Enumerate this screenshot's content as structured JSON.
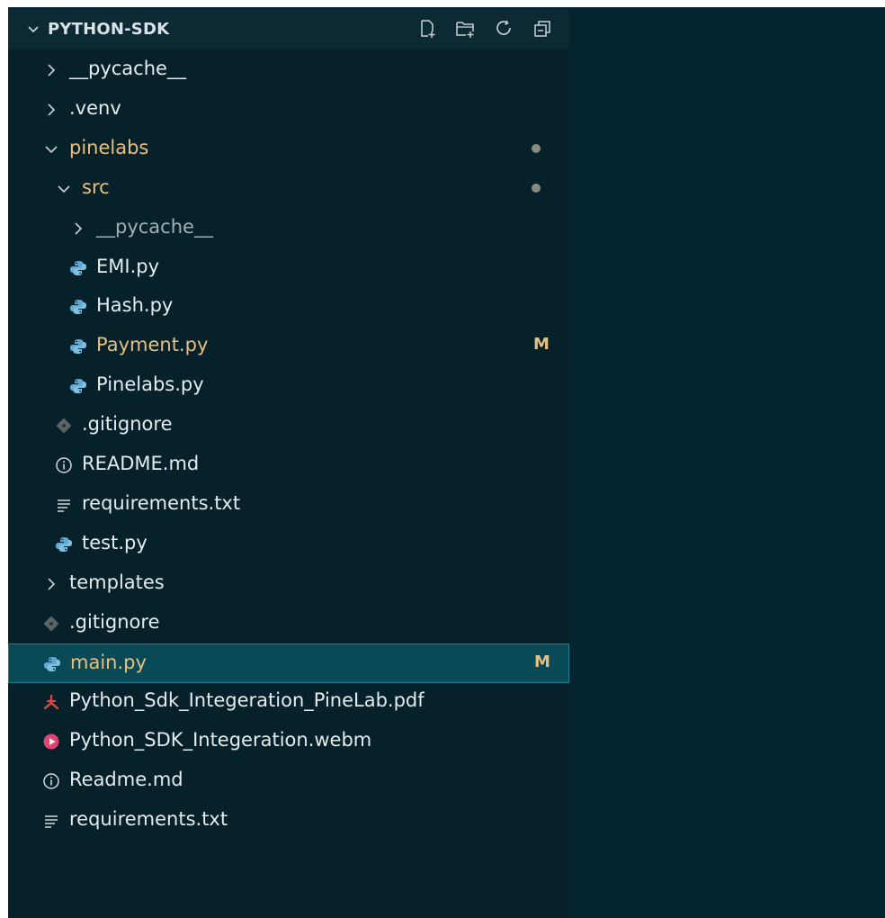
{
  "explorer": {
    "title": "PYTHON-SDK",
    "actions": [
      {
        "name": "new-file-icon"
      },
      {
        "name": "new-folder-icon"
      },
      {
        "name": "refresh-icon"
      },
      {
        "name": "collapse-all-icon"
      }
    ],
    "items": [
      {
        "label": "__pycache__",
        "kind": "folder",
        "expanded": false,
        "depth": 1
      },
      {
        "label": ".venv",
        "kind": "folder",
        "expanded": false,
        "depth": 1
      },
      {
        "label": "pinelabs",
        "kind": "folder",
        "expanded": true,
        "depth": 1,
        "modified_dot": true
      },
      {
        "label": "src",
        "kind": "folder",
        "expanded": true,
        "depth": 2,
        "modified_dot": true
      },
      {
        "label": "__pycache__",
        "kind": "folder",
        "expanded": false,
        "depth": 3
      },
      {
        "label": "EMI.py",
        "kind": "python",
        "depth": 3
      },
      {
        "label": "Hash.py",
        "kind": "python",
        "depth": 3
      },
      {
        "label": "Payment.py",
        "kind": "python",
        "depth": 3,
        "badge": "M"
      },
      {
        "label": "Pinelabs.py",
        "kind": "python",
        "depth": 3
      },
      {
        "label": ".gitignore",
        "kind": "git",
        "depth": 2
      },
      {
        "label": "README.md",
        "kind": "info",
        "depth": 2
      },
      {
        "label": "requirements.txt",
        "kind": "text",
        "depth": 2
      },
      {
        "label": "test.py",
        "kind": "python",
        "depth": 2
      },
      {
        "label": "templates",
        "kind": "folder",
        "expanded": false,
        "depth": 1
      },
      {
        "label": ".gitignore",
        "kind": "git",
        "depth": 1
      },
      {
        "label": "main.py",
        "kind": "python",
        "depth": 1,
        "badge": "M",
        "selected": true
      },
      {
        "label": "Python_Sdk_Integeration_PineLab.pdf",
        "kind": "pdf",
        "depth": 1
      },
      {
        "label": "Python_SDK_Integeration.webm",
        "kind": "video",
        "depth": 1
      },
      {
        "label": "Readme.md",
        "kind": "info",
        "depth": 1
      },
      {
        "label": "requirements.txt",
        "kind": "text",
        "depth": 1
      }
    ]
  },
  "colors": {
    "background": "#06212a",
    "header": "#0b2a34",
    "selection": "#0a4a57",
    "modified": "#e7c081",
    "python_icon": "#5fa8d3",
    "pdf_icon": "#e04a3f",
    "video_icon": "#e0446f"
  }
}
